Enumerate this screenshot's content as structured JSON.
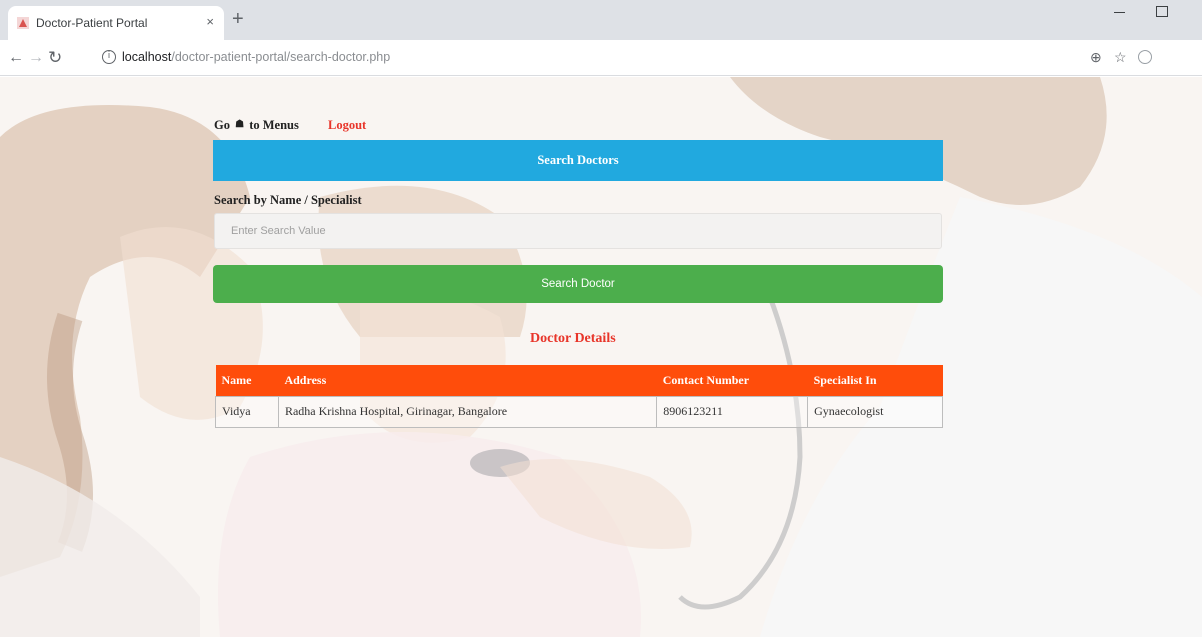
{
  "browser": {
    "tab_title": "Doctor-Patient Portal",
    "tab_close": "×",
    "new_tab": "+",
    "url_host": "localhost",
    "url_path": "/doctor-patient-portal/search-doctor.php"
  },
  "nav": {
    "go_prefix": "Go",
    "home_glyph": "☗",
    "menus_text": "to Menus",
    "logout": "Logout"
  },
  "header": {
    "title": "Search Doctors"
  },
  "search": {
    "label": "Search by Name / Specialist",
    "placeholder": "Enter Search Value",
    "value": "",
    "button": "Search Doctor"
  },
  "details": {
    "title": "Doctor Details",
    "columns": [
      "Name",
      "Address",
      "Contact Number",
      "Specialist In"
    ],
    "rows": [
      [
        "Vidya",
        "Radha Krishna Hospital, Girinagar, Bangalore",
        "8906123211",
        "Gynaecologist"
      ]
    ]
  },
  "colors": {
    "header_blue": "#21a9df",
    "search_green": "#4cae4c",
    "table_header_orange": "#ff4d0b",
    "logout_red": "#e8352a"
  }
}
